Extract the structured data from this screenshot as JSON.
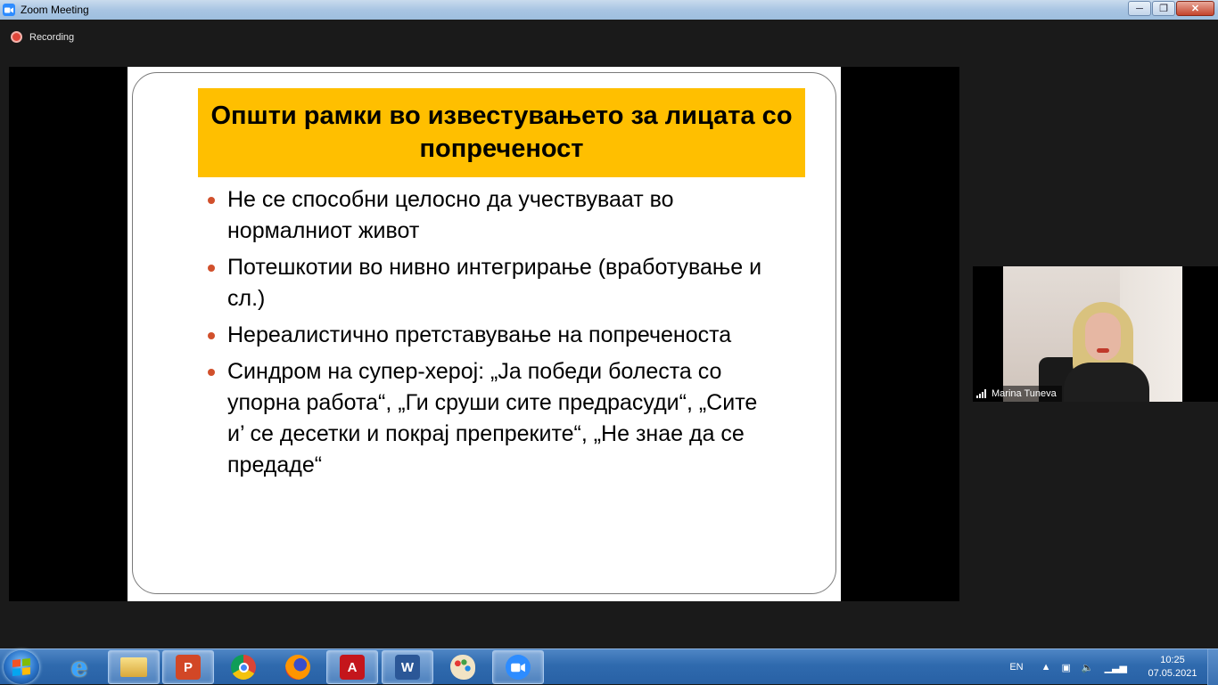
{
  "window": {
    "title": "Zoom Meeting",
    "minimize": "─",
    "maximize": "❐",
    "close": "✕"
  },
  "recording": {
    "label": "Recording"
  },
  "slide": {
    "title": "Општи рамки во известувањето за лицата со попреченост",
    "bullets": [
      "Не се способни целосно да учествуваат во нормалниот живот",
      "Потешкотии во нивно интегрирање (вработување и сл.)",
      "Нереалистично претставување на попреченоста",
      "Синдром на супер-херој: „Ја победи болеста со упорна работа“, „Ги сруши сите предрасуди“, „Сите и’ се десетки и покрај препреките“, „Не знае да се предаде“"
    ],
    "title_bg": "#ffbf00",
    "bullet_color": "#d1502c"
  },
  "participant": {
    "name": "Marina Tuneva"
  },
  "taskbar": {
    "apps": [
      {
        "name": "internet-explorer-icon",
        "glyph": "e"
      },
      {
        "name": "file-explorer-icon",
        "glyph": ""
      },
      {
        "name": "powerpoint-icon",
        "glyph": "P"
      },
      {
        "name": "chrome-icon",
        "glyph": ""
      },
      {
        "name": "firefox-icon",
        "glyph": ""
      },
      {
        "name": "acrobat-icon",
        "glyph": "A"
      },
      {
        "name": "word-icon",
        "glyph": "W"
      },
      {
        "name": "paint-icon",
        "glyph": ""
      },
      {
        "name": "zoom-icon",
        "glyph": ""
      }
    ],
    "language": "EN",
    "time": "10:25",
    "date": "07.05.2021"
  }
}
